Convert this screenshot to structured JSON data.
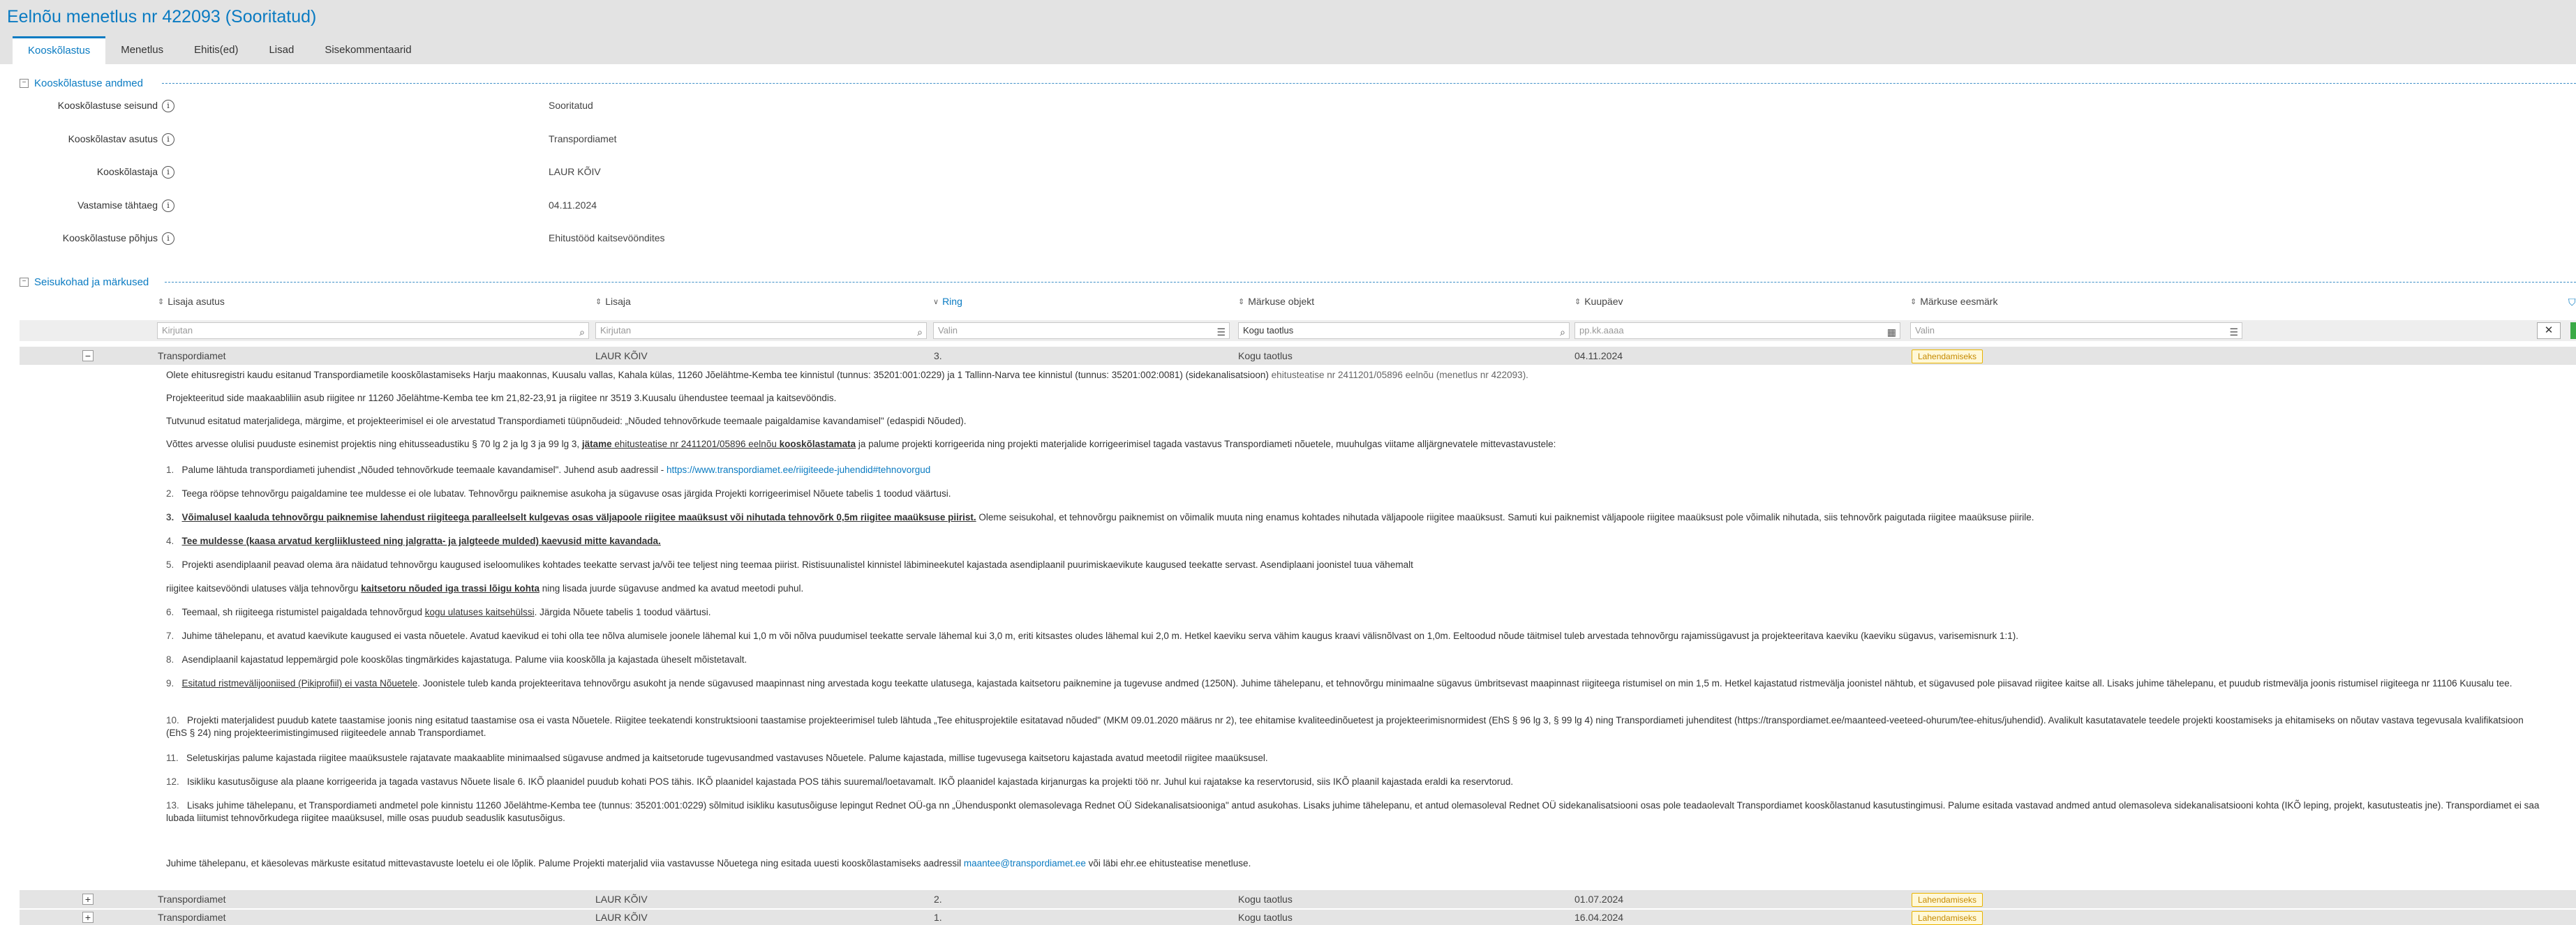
{
  "page": {
    "title": "Eelnõu menetlus nr 422093 (Sooritatud)"
  },
  "tabs": [
    {
      "label": "Kooskõlastus"
    },
    {
      "label": "Menetlus"
    },
    {
      "label": "Ehitis(ed)"
    },
    {
      "label": "Lisad"
    },
    {
      "label": "Sisekommentaarid"
    }
  ],
  "approval_section": {
    "title": "Kooskõlastuse andmed",
    "fields": [
      {
        "label": "Kooskõlastuse seisund",
        "value": "Sooritatud"
      },
      {
        "label": "Kooskõlastav asutus",
        "value": "Transpordiamet"
      },
      {
        "label": "Kooskõlastaja",
        "value": "LAUR KÕIV"
      },
      {
        "label": "Vastamise tähtaeg",
        "value": "04.11.2024"
      },
      {
        "label": "Kooskõlastuse põhjus",
        "value": "Ehitustööd kaitsevööndites"
      }
    ]
  },
  "remarks_section": {
    "title": "Seisukohad ja märkused",
    "columns": [
      "Lisaja asutus",
      "Lisaja",
      "Ring",
      "Märkuse objekt",
      "Kuupäev",
      "Märkuse eesmärk"
    ],
    "filters": {
      "agency_placeholder": "Kirjutan",
      "author_placeholder": "Kirjutan",
      "round_placeholder": "Valin",
      "object_value": "Kogu taotlus",
      "date_placeholder": "pp.kk.aaaa",
      "purpose_placeholder": "Valin"
    },
    "rows": [
      {
        "expander": "−",
        "agency": "Transpordiamet",
        "author": "LAUR KÕIV",
        "round": "3.",
        "object": "Kogu taotlus",
        "date": "04.11.2024",
        "purpose": "Lahendamiseks"
      },
      {
        "expander": "+",
        "agency": "Transpordiamet",
        "author": "LAUR KÕIV",
        "round": "2.",
        "object": "Kogu taotlus",
        "date": "01.07.2024",
        "purpose": "Lahendamiseks"
      },
      {
        "expander": "+",
        "agency": "Transpordiamet",
        "author": "LAUR KÕIV",
        "round": "1.",
        "object": "Kogu taotlus",
        "date": "16.04.2024",
        "purpose": "Lahendamiseks"
      }
    ]
  },
  "detail": {
    "intro_a": "Olete ehitusregistri kaudu esitanud Transpordiametile kooskõlastamiseks Harju maakonnas, Kuusalu vallas, Kahala külas, 11260 Jõelähtme-Kemba tee kinnistul (tunnus: 35201:001:0229) ja 1 Tallinn-Narva tee kinnistul (tunnus: 35201:002:0081) (sidekanalisatsioon)",
    "intro_b": " ehitusteatise nr 2411201/05896 eelnõu (menetlus nr 422093).",
    "p2": "Projekteeritud side maakaabliliin asub riigitee nr 11260 Jõelähtme-Kemba tee km 21,82-23,91 ja riigitee nr 3519 3.Kuusalu ühendustee teemaal ja kaitsevööndis.",
    "p3": "Tutvunud esitatud materjalidega, märgime, et projekteerimisel ei ole arvestatud Transpordiameti tüüpnõudeid: „Nõuded tehnovõrkude teemaale paigaldamise kavandamisel\" (edaspidi Nõuded).",
    "p4_a": "Võttes arvesse olulisi puuduste esinemist projektis ning ehitusseadustiku § 70 lg 2 ja lg 3 ja 99 lg 3, ",
    "p4_b": "jätame",
    "p4_c": " ehitusteatise nr 2411201/05896 eelnõu ",
    "p4_d": "kooskõlastamata",
    "p4_e": " ja palume projekti korrigeerida ning projekti materjalide korrigeerimisel tagada vastavus Transpordiameti nõuetele, muuhulgas viitame alljärgnevatele mittevastavustele:",
    "i1_num": "1.",
    "i1_a": "Palume lähtuda transpordiameti juhendist „Nõuded tehnovõrkude teemaale kavandamisel\". Juhend asub aadressil - ",
    "i1_link": "https://www.transpordiamet.ee/riigiteede-juhendid#tehnovorgud",
    "i2_num": "2.",
    "i2": "Teega rööpse tehnovõrgu paigaldamine tee muldesse ei ole lubatav. Tehnovõrgu paiknemise asukoha ja sügavuse osas järgida Projekti korrigeerimisel Nõuete tabelis 1 toodud väärtusi.",
    "i3_num": "3.",
    "i3_a": "Võimalusel kaaluda tehnovõrgu paiknemise lahendust riigiteega paralleelselt kulgevas osas väljapoole riigitee maaüksust või nihutada tehnovõrk 0,5m riigitee maaüksuse piirist.",
    "i3_b": " Oleme seisukohal, et tehnovõrgu paiknemist on võimalik muuta ning enamus kohtades nihutada väljapoole riigitee maaüksust. Samuti kui paiknemist väljapoole riigitee maaüksust pole võimalik nihutada, siis tehnovõrk paigutada riigitee maaüksuse piirile.",
    "i4_num": "4.",
    "i4": "Tee muldesse (kaasa arvatud kergliiklusteed ning jalgratta- ja jalgteede mulded) kaevusid mitte kavandada.",
    "i5_num": "5.",
    "i5": "Projekti asendiplaanil peavad olema ära näidatud tehnovõrgu kaugused iseloomulikes kohtades teekatte servast ja/või tee teljest ning teemaa piirist. Ristisuunalistel kinnistel läbimineekutel kajastada asendiplaanil puurimiskaevikute kaugused teekatte servast. Asendiplaani joonistel tuua vähemalt",
    "i5b_a": "riigitee kaitsevööndi ulatuses välja tehnovõrgu ",
    "i5b_link": "kaitsetoru nõuded iga trassi lõigu kohta",
    "i5b_c": " ning lisada juurde sügavuse andmed ka avatud meetodi puhul.",
    "i6_num": "6.",
    "i6_a": "Teemaal, sh riigiteega ristumistel paigaldada tehnovõrgud ",
    "i6_link": "kogu ulatuses kaitsehülssi",
    "i6_c": ". Järgida Nõuete tabelis 1 toodud väärtusi.",
    "i7_num": "7.",
    "i7": "Juhime tähelepanu, et avatud kaevikute kaugused ei vasta nõuetele. Avatud kaevikud ei tohi olla tee nõlva alumisele joonele lähemal kui 1,0 m või nõlva puudumisel teekatte servale lähemal kui 3,0 m, eriti kitsastes oludes lähemal kui 2,0 m. Hetkel kaeviku serva vähim kaugus kraavi välisnõlvast on 1,0m. Eeltoodud nõude täitmisel tuleb arvestada tehnovõrgu rajamissügavust ja projekteeritava kaeviku (kaeviku sügavus, varisemisnurk 1:1).",
    "i8_num": "8.",
    "i8": "Asendiplaanil kajastatud leppemärgid pole kooskõlas tingmärkides kajastatuga. Palume viia kooskõlla ja kajastada üheselt mõistetavalt.",
    "i9_num": "9.",
    "i9_link": "Esitatud ristmevälijooniised (Pikiprofiil) ei vasta Nõuetele",
    "i9_b": ". Joonistele tuleb kanda projekteeritava tehnovõrgu asukoht ja nende sügavused maapinnast ning arvestada kogu teekatte ulatusega, kajastada kaitsetoru paiknemine ja tugevuse andmed (1250N). Juhime tähelepanu, et tehnovõrgu minimaalne sügavus ümbritsevast maapinnast riigiteega ristumisel on min 1,5 m. Hetkel kajastatud ristmevälja joonistel nähtub, et sügavused pole piisavad riigitee kaitse all. Lisaks juhime tähelepanu, et puudub ristmevälja joonis ristumisel riigiteega nr 11106 Kuusalu tee.",
    "i10_num": "10.",
    "i10": "Projekti materjalidest puudub katete taastamise joonis ning esitatud taastamise osa ei vasta Nõuetele. Riigitee teekatendi konstruktsiooni taastamise projekteerimisel tuleb lähtuda „Tee ehitusprojektile esitatavad nõuded\" (MKM 09.01.2020 määrus nr 2), tee ehitamise kvaliteedinõuetest ja projekteerimisnormidest (EhS § 96 lg 3, § 99 lg 4) ning Transpordiameti juhenditest (https://transpordiamet.ee/maanteed-veeteed-ohurum/tee-ehitus/juhendid). Avalikult kasutatavatele teedele projekti koostamiseks ja ehitamiseks on nõutav vastava tegevusala kvalifikatsioon (EhS § 24) ning projekteerimistingimused riigiteedele annab Transpordiamet.",
    "i11_num": "11.",
    "i11": "Seletuskirjas palume kajastada riigitee maaüksustele rajatavate maakaablite minimaalsed sügavuse andmed ja kaitsetorude tugevusandmed vastavuses Nõuetele. Palume kajastada, millise tugevusega kaitsetoru kajastada avatud meetodil riigitee maaüksusel.",
    "i12_num": "12.",
    "i12": "Isikliku kasutusõiguse ala plaane korrigeerida ja tagada vastavus Nõuete lisale 6. IKÕ plaanidel puudub kohati POS tähis. IKÕ plaanidel kajastada POS tähis suuremal/loetavamalt. IKÕ plaanidel kajastada kirjanurgas ka projekti töö nr. Juhul kui rajatakse ka reservtorusid, siis IKÕ plaanil kajastada eraldi ka reservtorud.",
    "i13_num": "13.",
    "i13": "Lisaks juhime tähelepanu, et Transpordiameti andmetel pole kinnistu 11260 Jõelähtme-Kemba tee (tunnus: 35201:001:0229) sõlmitud isikliku kasutusõiguse lepingut Rednet OÜ-ga nn „Ühendusponkt olemasolevaga Rednet OÜ Sidekanalisatsiooniga\" antud asukohas. Lisaks juhime tähelepanu, et antud olemasoleval Rednet OÜ sidekanalisatsiooni osas pole teadaolevalt Transpordiamet kooskõlastanud kasutustingimusi. Palume esitada vastavad andmed antud olemasoleva sidekanalisatsiooni kohta (IKÕ leping, projekt, kasutusteatis jne). Transpordiamet ei saa lubada liitumist tehnovõrkudega riigitee maaüksusel, mille osas puudub seaduslik kasutusõigus.",
    "closing_a": "Juhime tähelepanu, et käesolevas märkuste esitatud mittevastavuste loetelu ei ole lõplik. Palume Projekti materjalid viia vastavusse Nõuetega ning esitada uuesti kooskõlastamiseks aadressil ",
    "closing_link": "maantee@transpordiamet.ee",
    "closing_c": " või läbi ehr.ee ehitusteatise menetluse."
  },
  "colors": {
    "accent": "#0a7bc2",
    "header_bg": "#e3e3e3",
    "badge_border": "#e9b400",
    "ok_button": "#3aaa46"
  }
}
